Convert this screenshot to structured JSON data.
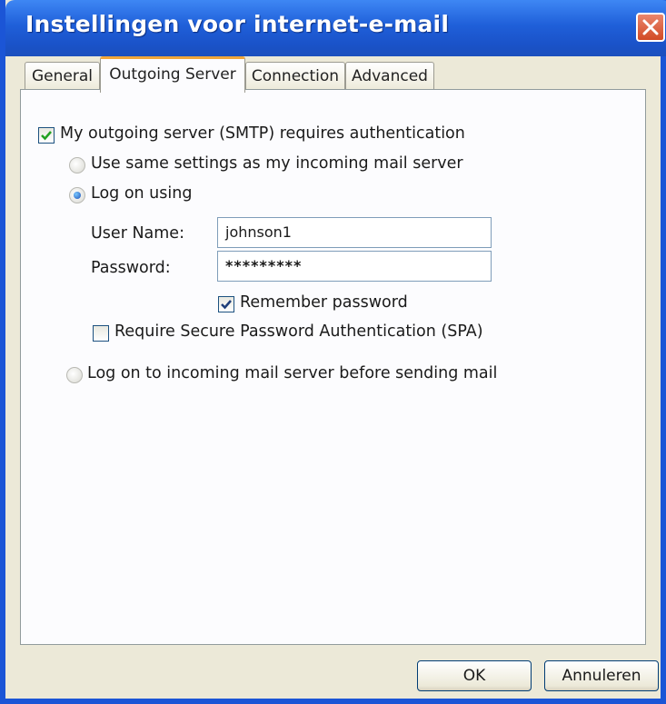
{
  "window": {
    "title": "Instellingen voor internet-e-mail",
    "colors": {
      "titlebar": "#1f5fd9",
      "frame": "#ece9d8",
      "close": "#d24a25"
    }
  },
  "tabs": [
    {
      "label": "General",
      "selected": false
    },
    {
      "label": "Outgoing Server",
      "selected": true
    },
    {
      "label": "Connection",
      "selected": false
    },
    {
      "label": "Advanced",
      "selected": false
    }
  ],
  "outgoing": {
    "requires_auth_label": "My outgoing server (SMTP) requires authentication",
    "requires_auth_checked": true,
    "same_settings_label": "Use same settings as my incoming mail server",
    "log_on_using_label": "Log on using",
    "selected_option": "log_on_using",
    "user_name_label": "User Name:",
    "user_name_value": "johnson1",
    "password_label": "Password:",
    "password_value": "*********",
    "remember_password_label": "Remember password",
    "remember_password_checked": true,
    "spa_label": "Require Secure Password Authentication (SPA)",
    "spa_checked": false,
    "log_on_incoming_label": "Log on to incoming mail server before sending mail"
  },
  "footer": {
    "ok_label": "OK",
    "cancel_label": "Annuleren"
  },
  "icons": [
    "close-icon",
    "checkmark-icon",
    "radio-dot-icon"
  ]
}
